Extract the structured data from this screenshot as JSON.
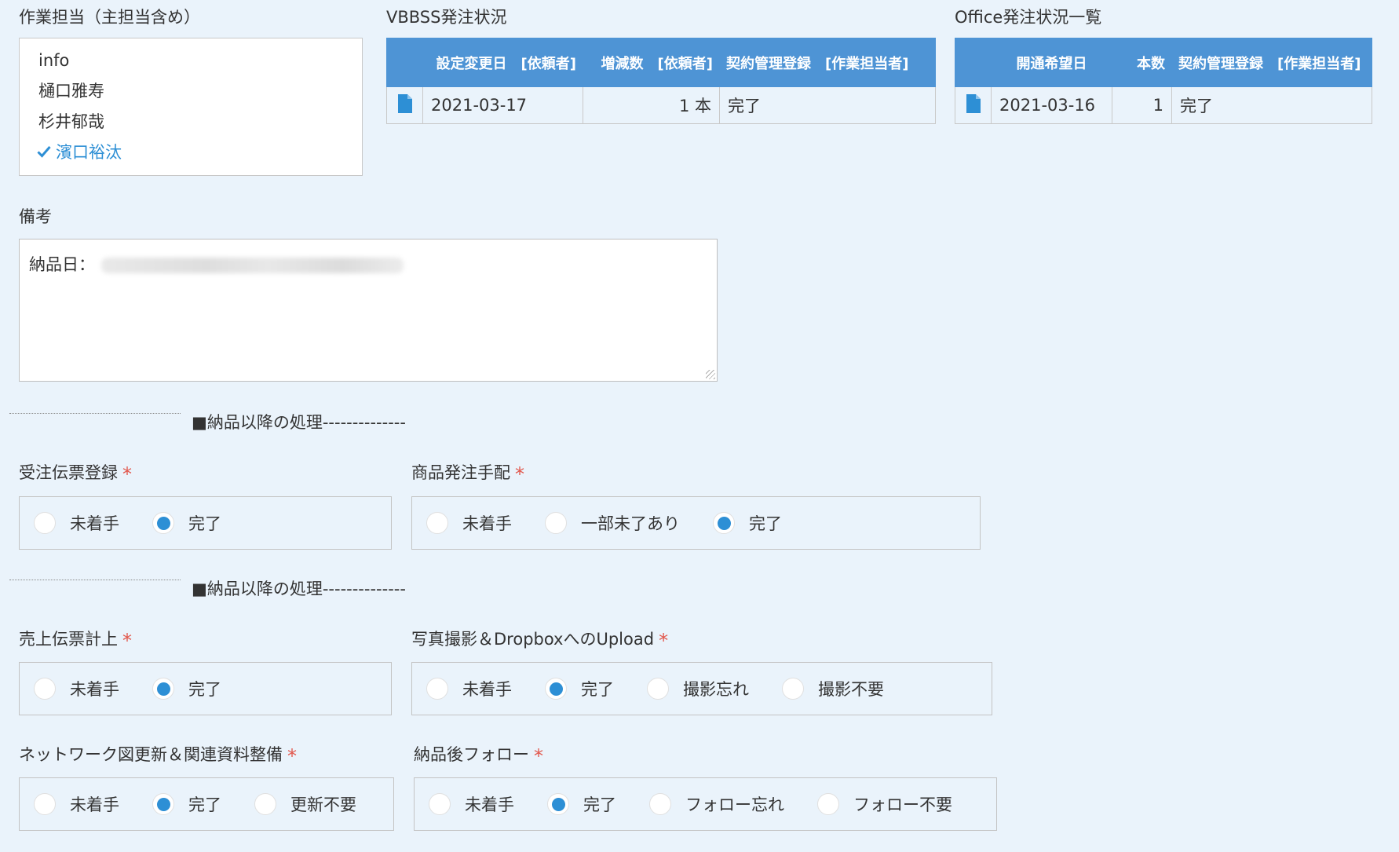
{
  "assignee": {
    "label": "作業担当（主担当含め）",
    "items": [
      {
        "name": "info",
        "selected": false
      },
      {
        "name": "樋口雅寿",
        "selected": false
      },
      {
        "name": "杉井郁哉",
        "selected": false
      },
      {
        "name": "濱口裕汰",
        "selected": true
      }
    ],
    "check_icon": "check-icon"
  },
  "vbbss": {
    "label": "VBBSS発注状況",
    "headers": [
      "",
      "設定変更日",
      "[依頼者]",
      "増減数",
      "[依頼者]",
      "契約管理登録",
      "[作業担当者]"
    ],
    "row": {
      "date": "2021-03-17",
      "qty": "1 本",
      "status": "完了"
    }
  },
  "office": {
    "label": "Office発注状況一覧",
    "headers": [
      "",
      "開通希望日",
      "本数",
      "契約管理登録",
      "[作業担当者]"
    ],
    "row": {
      "date": "2021-03-16",
      "qty": "1",
      "status": "完了"
    }
  },
  "notes": {
    "label": "備考",
    "text": "納品日："
  },
  "section_1": {
    "title": "■納品以降の処理--------------"
  },
  "section_2": {
    "title": "■納品以降の処理--------------"
  },
  "required_mark": "*",
  "groups": {
    "order_slip": {
      "label": "受注伝票登録",
      "options": [
        "未着手",
        "完了"
      ],
      "selected": "完了"
    },
    "product_order": {
      "label": "商品発注手配",
      "options": [
        "未着手",
        "一部未了あり",
        "完了"
      ],
      "selected": "完了"
    },
    "sales_slip": {
      "label": "売上伝票計上",
      "options": [
        "未着手",
        "完了"
      ],
      "selected": "完了"
    },
    "photo_upload": {
      "label": "写真撮影＆DropboxへのUpload",
      "options": [
        "未着手",
        "完了",
        "撮影忘れ",
        "撮影不要"
      ],
      "selected": "完了"
    },
    "network_map": {
      "label": "ネットワーク図更新＆関連資料整備",
      "options": [
        "未着手",
        "完了",
        "更新不要"
      ],
      "selected": "完了"
    },
    "follow_up": {
      "label": "納品後フォロー",
      "options": [
        "未着手",
        "完了",
        "フォロー忘れ",
        "フォロー不要"
      ],
      "selected": "完了"
    }
  },
  "colors": {
    "accent": "#2d8fd5",
    "table_header": "#4e94d5",
    "required": "#e2574c",
    "background": "#eaf3fb"
  }
}
